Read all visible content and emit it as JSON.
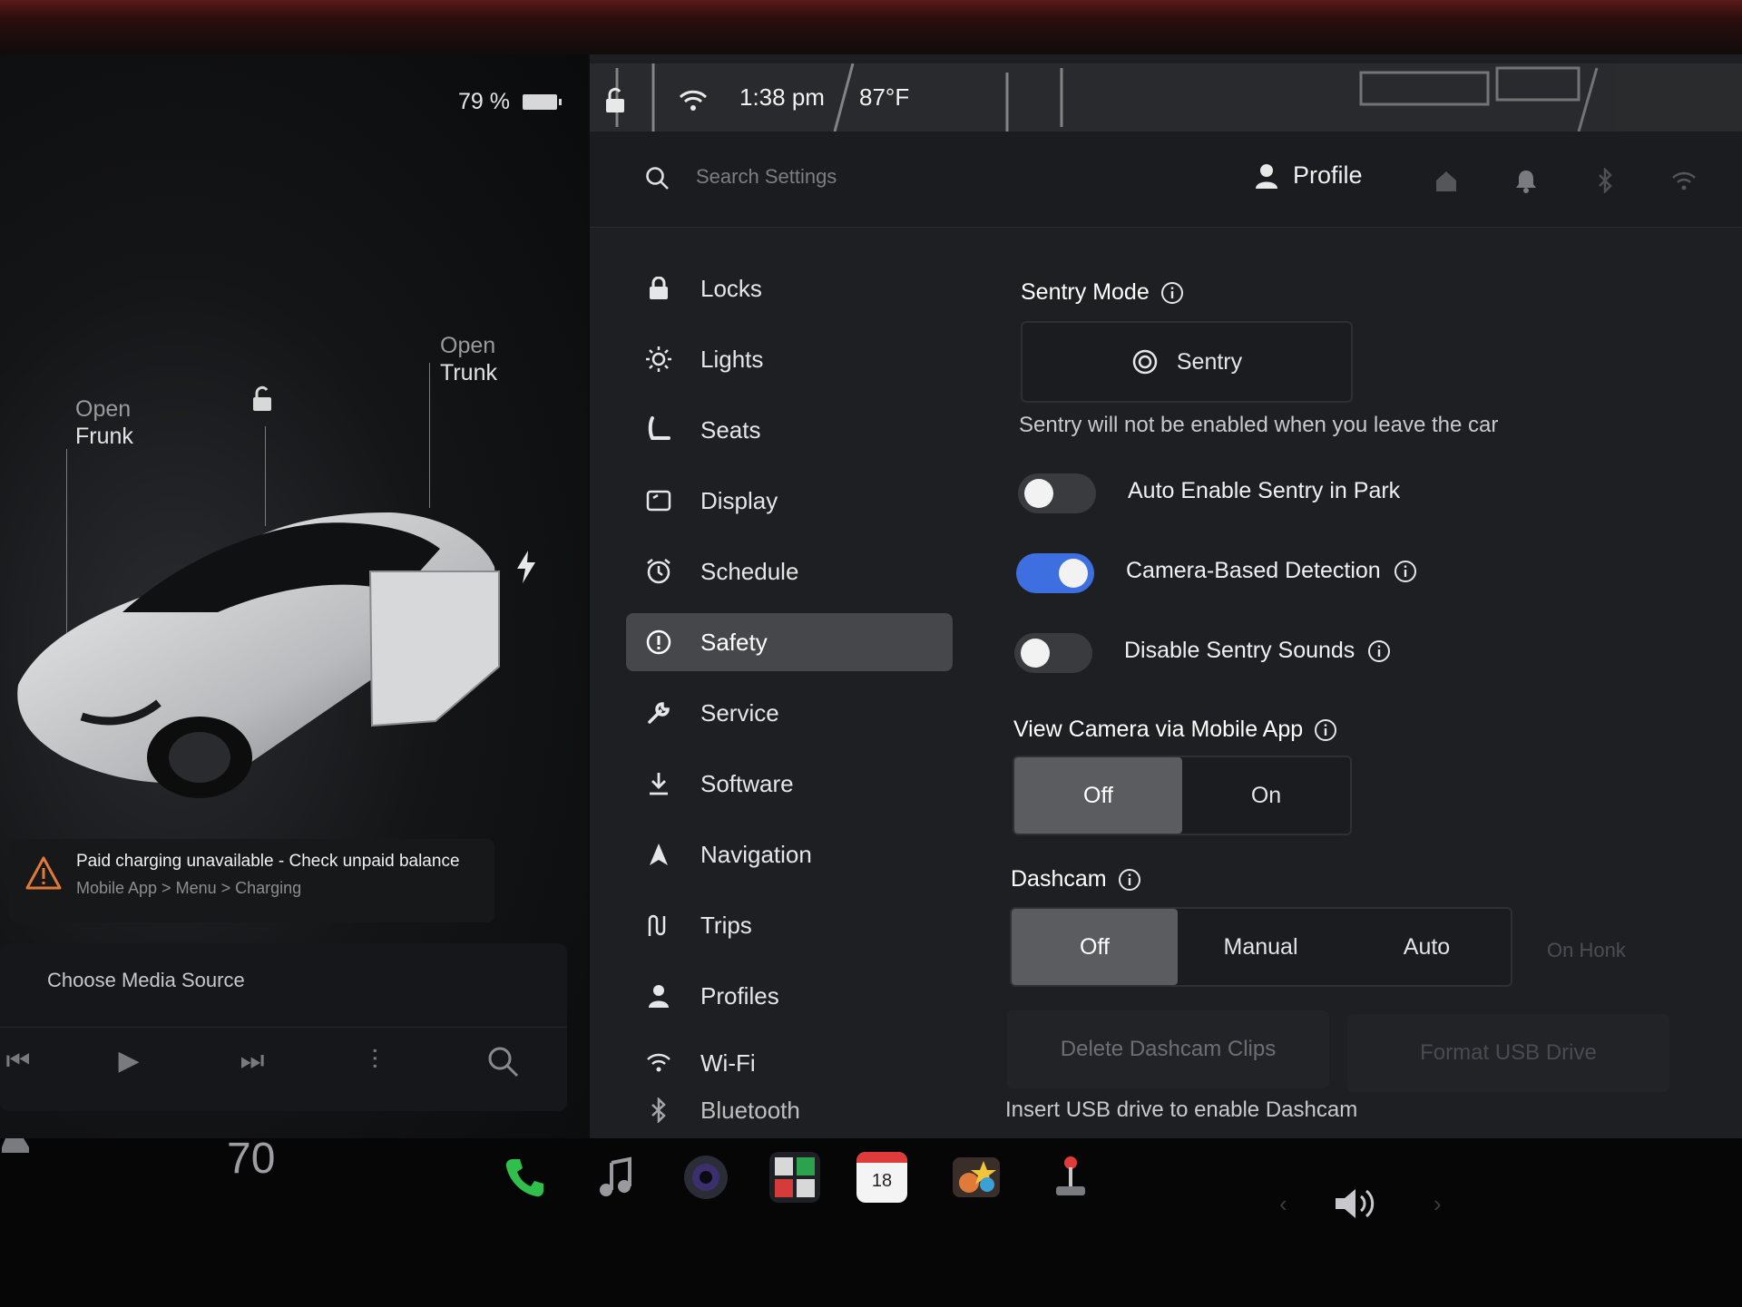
{
  "status_bar": {
    "battery": "79 %",
    "time": "1:38 pm",
    "temperature": "87°F"
  },
  "car_panel": {
    "frunk": {
      "line1": "Open",
      "line2": "Frunk"
    },
    "trunk": {
      "line1": "Open",
      "line2": "Trunk"
    },
    "alert": {
      "title": "Paid charging unavailable - Check unpaid balance",
      "path": "Mobile App > Menu > Charging"
    },
    "media": {
      "source": "Choose Media Source"
    }
  },
  "header": {
    "search_placeholder": "Search Settings",
    "profile": "Profile"
  },
  "menu": [
    {
      "label": "Locks",
      "icon": "lock-icon"
    },
    {
      "label": "Lights",
      "icon": "sun-icon"
    },
    {
      "label": "Seats",
      "icon": "seat-icon"
    },
    {
      "label": "Display",
      "icon": "display-icon"
    },
    {
      "label": "Schedule",
      "icon": "alarm-icon"
    },
    {
      "label": "Safety",
      "icon": "safety-icon",
      "active": true
    },
    {
      "label": "Service",
      "icon": "wrench-icon"
    },
    {
      "label": "Software",
      "icon": "download-icon"
    },
    {
      "label": "Navigation",
      "icon": "navigation-icon"
    },
    {
      "label": "Trips",
      "icon": "trips-icon"
    },
    {
      "label": "Profiles",
      "icon": "person-icon"
    },
    {
      "label": "Wi-Fi",
      "icon": "wifi-icon"
    },
    {
      "label": "Bluetooth",
      "icon": "bluetooth-icon"
    }
  ],
  "safety": {
    "sentry_mode": {
      "title": "Sentry Mode",
      "button": "Sentry",
      "note": "Sentry will not be enabled when you leave the car"
    },
    "toggles": [
      {
        "label": "Auto Enable Sentry in Park",
        "on": false
      },
      {
        "label": "Camera-Based Detection",
        "on": true
      },
      {
        "label": "Disable Sentry Sounds",
        "on": false
      }
    ],
    "view_camera": {
      "title": "View Camera via Mobile App",
      "options": [
        "Off",
        "On"
      ],
      "selected": "Off"
    },
    "dashcam": {
      "title": "Dashcam",
      "options": [
        "Off",
        "Manual",
        "Auto"
      ],
      "extra_option": "On Honk",
      "selected": "Off",
      "delete_clips": "Delete Dashcam Clips",
      "format_usb": "Format USB Drive",
      "note": "Insert USB drive to enable Dashcam"
    }
  },
  "dock": {
    "speed": "70",
    "calendar_day": "18"
  },
  "colors": {
    "accent": "#3e6fe0",
    "active_menu": "#46474b",
    "phone": "#2fbf4a"
  }
}
